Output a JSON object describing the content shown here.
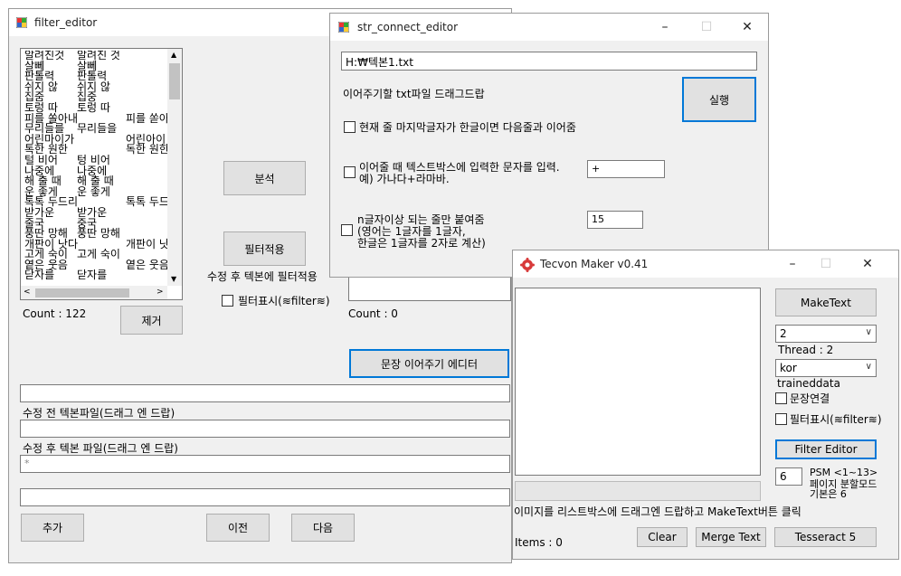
{
  "filter_editor": {
    "title": "filter_editor",
    "list_rows": [
      [
        "알려진것",
        "알려진 것",
        ""
      ],
      [
        "살뻬",
        "살뻬",
        ""
      ],
      [
        "판톨력",
        "판톨력",
        ""
      ],
      [
        "쉬지 않",
        "쉬지 않",
        ""
      ],
      [
        "집줌",
        "집중",
        ""
      ],
      [
        "토렁 따",
        "토렁 따",
        ""
      ],
      [
        "피를 쏠아내",
        "",
        "피를 쏟아"
      ],
      [
        "무리들를",
        "무리들을",
        ""
      ],
      [
        "어린마이가",
        "",
        "어린아이"
      ],
      [
        "톡한 원한",
        "",
        "독한 원한"
      ],
      [
        "털 비어",
        "텅 비어",
        ""
      ],
      [
        "나중에",
        "나중에",
        ""
      ],
      [
        "해 출 때",
        "해 출 때",
        ""
      ],
      [
        "운 좋게",
        "운 좋게",
        ""
      ],
      [
        "톡톡 두드리",
        "",
        "톡톡 두드"
      ],
      [
        "받가운",
        "받가운",
        ""
      ],
      [
        "줄국",
        "중국",
        ""
      ],
      [
        "풍딴 망해",
        "풍딴 망해",
        ""
      ],
      [
        "개판이 낫다",
        "",
        "개판이 낫"
      ],
      [
        "고게 숙이",
        "고게 숙이",
        ""
      ],
      [
        "옅은 웃음",
        "",
        "옅은 웃음"
      ],
      [
        "닫자를",
        "닫자를",
        ""
      ]
    ],
    "count_label": "Count : 122",
    "remove_button": "제거",
    "analyze_button": "분석",
    "apply_filter_button": "필터적용",
    "apply_after_label": "수정 후 텍본에 필터적용",
    "show_filter_label": "필터표시(≋filter≋)",
    "right_count_label": "Count : 0",
    "sentence_editor_button": "문장 이어주기 에디터",
    "before_file_label": "수정 전 텍본파일(드래그 엔 드랍)",
    "after_file_label": "수정 후 텍본 파일(드래그 엔 드랍)",
    "input_star_value": "*",
    "add_button": "추가",
    "prev_button": "이전",
    "next_button": "다음"
  },
  "str_connect_editor": {
    "title": "str_connect_editor",
    "path_value": "H:₩텍본1.txt",
    "drop_label": "이어주기할 txt파일 드래그드랍",
    "run_button": "실행",
    "opt1_label": "현재 줄 마지막글자가 한글이면 다음줄과 이어줌",
    "opt2_line1": "이어줄 때 텍스트박스에 입력한 문자를 입력.",
    "opt2_line2": "예) 가나다+라마바.",
    "opt2_value": "+",
    "opt3_line1": "n글자이상 되는 줄만 붙여줌",
    "opt3_line2": "(영어는 1글자를 1글자,",
    "opt3_line3": "한글은 1글자를 2자로 계산)",
    "opt3_value": "15"
  },
  "tecvon_maker": {
    "title": "Tecvon Maker v0.41",
    "maketext_button": "MakeText",
    "thread_value": "2",
    "thread_label": "Thread : 2",
    "lang_value": "kor",
    "traineddata_label": "traineddata",
    "sentence_connect_label": "문장연결",
    "show_filter_label": "필터표시(≋filter≋)",
    "filter_editor_button": "Filter Editor",
    "psm_value": "6",
    "psm_line1": "PSM <1~13>",
    "psm_line2": "페이지 분할모드",
    "psm_line3": "기본은 6",
    "hint_label": "이미지를 리스트박스에 드래그엔 드랍하고 MakeText버튼 클릭",
    "items_label": "Items : 0",
    "clear_button": "Clear",
    "merge_button": "Merge Text",
    "tesseract_button": "Tesseract 5"
  }
}
